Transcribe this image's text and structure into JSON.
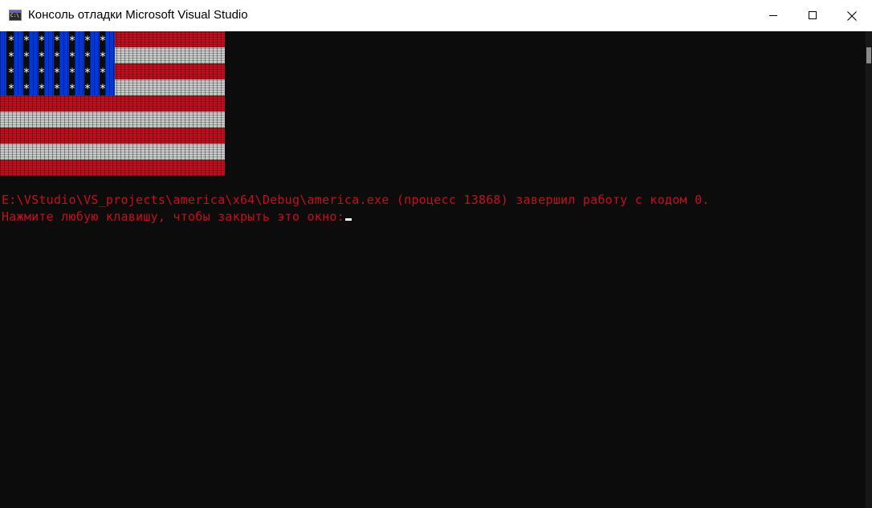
{
  "window": {
    "title": "Консоль отладки Microsoft Visual Studio",
    "icon": "console-app-icon",
    "icon_text": "C:\\"
  },
  "controls": {
    "minimize_icon": "minimize-icon",
    "maximize_icon": "maximize-icon",
    "close_icon": "close-icon"
  },
  "console": {
    "background": "#0c0c0c",
    "text_color": "#c50f1f",
    "flag": {
      "stripes": [
        "red",
        "white",
        "red",
        "white",
        "red",
        "white",
        "red",
        "white",
        "red"
      ],
      "canton_color": "#0037da",
      "stripe_red": "#c50f1f",
      "stripe_white": "#cccccc",
      "star_glyph": "*",
      "star_rows": 4,
      "star_cols": 7
    },
    "lines": [
      "E:\\VStudio\\VS_projects\\america\\x64\\Debug\\america.exe (процесс 13868) завершил работу с кодом 0.",
      "Нажмите любую клавишу, чтобы закрыть это окно:"
    ]
  }
}
